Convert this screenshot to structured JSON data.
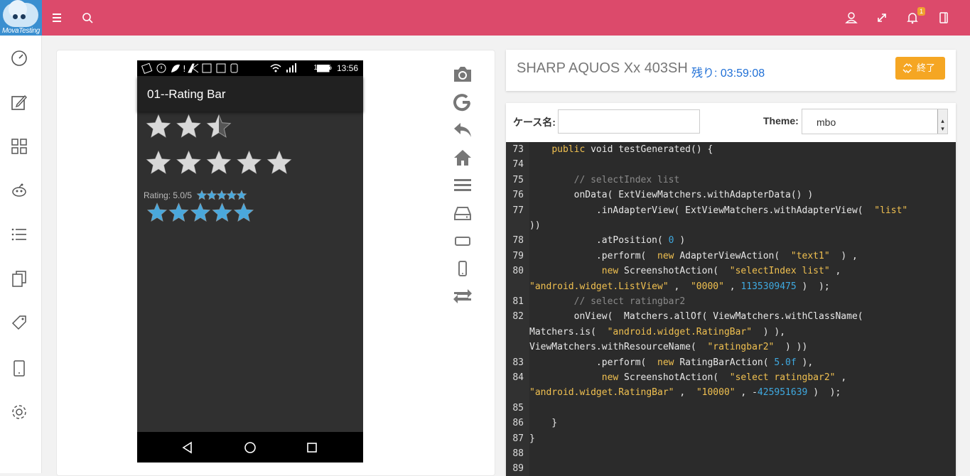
{
  "app": {
    "logo_text": "MovaTesting",
    "notification_count": "1"
  },
  "device_screen": {
    "status_battery": "100%",
    "status_time": "13:56",
    "app_title": "01--Rating Bar",
    "rating_label": "Rating: 5.0/5",
    "ratingbar1_stars": 2.5,
    "ratingbar2_stars": 5,
    "ratingbar3_stars": 5,
    "star_accent": "#4aa8dc"
  },
  "device_info": {
    "name": "SHARP AQUOS Xx 403SH",
    "remaining": "残り: 03:59:08",
    "end_button": "終了"
  },
  "editor": {
    "case_label": "ケース名:",
    "case_value": "",
    "theme_label": "Theme:",
    "theme_value": "mbo"
  },
  "colors": {
    "topbar": "#dc4a6b",
    "end_button": "#f5a623",
    "remain_text": "#1f6fd6"
  },
  "code_lines": [
    {
      "n": "73",
      "segs": [
        [
          "",
          "    "
        ],
        [
          "kw",
          "public"
        ],
        [
          "",
          " void testGenerated() {"
        ]
      ]
    },
    {
      "n": "74",
      "segs": []
    },
    {
      "n": "75",
      "segs": [
        [
          "",
          "        "
        ],
        [
          "cm",
          "// selectIndex list"
        ]
      ]
    },
    {
      "n": "76",
      "segs": [
        [
          "",
          "        onData( ExtViewMatchers.withAdapterData() )"
        ]
      ]
    },
    {
      "n": "77",
      "segs": [
        [
          "",
          "            .inAdapterView( ExtViewMatchers.withAdapterView(  "
        ],
        [
          "st",
          "\"list\""
        ]
      ]
    },
    {
      "n": "",
      "segs": [
        [
          "",
          "))"
        ]
      ]
    },
    {
      "n": "78",
      "segs": [
        [
          "",
          "            .atPosition( "
        ],
        [
          "nm",
          "0"
        ],
        [
          "",
          " )"
        ]
      ]
    },
    {
      "n": "79",
      "segs": [
        [
          "",
          "            .perform(  "
        ],
        [
          "kw",
          "new"
        ],
        [
          "",
          " AdapterViewAction(  "
        ],
        [
          "st",
          "\"text1\""
        ],
        [
          "",
          "  ) ,"
        ]
      ]
    },
    {
      "n": "80",
      "segs": [
        [
          "",
          "             "
        ],
        [
          "kw",
          "new"
        ],
        [
          "",
          " ScreenshotAction(  "
        ],
        [
          "st",
          "\"selectIndex list\""
        ],
        [
          "",
          " ,"
        ]
      ]
    },
    {
      "n": "",
      "segs": [
        [
          "st",
          "\"android.widget.ListView\""
        ],
        [
          "",
          " ,  "
        ],
        [
          "st",
          "\"0000\""
        ],
        [
          "",
          " , "
        ],
        [
          "nm",
          "1135309475"
        ],
        [
          "",
          " )  );"
        ]
      ]
    },
    {
      "n": "81",
      "segs": [
        [
          "",
          "        "
        ],
        [
          "cm",
          "// select ratingbar2"
        ]
      ]
    },
    {
      "n": "82",
      "segs": [
        [
          "",
          "        onView(  Matchers.allOf( ViewMatchers.withClassName("
        ]
      ]
    },
    {
      "n": "",
      "segs": [
        [
          "",
          "Matchers.is(  "
        ],
        [
          "st",
          "\"android.widget.RatingBar\""
        ],
        [
          "",
          "  ) ),"
        ]
      ]
    },
    {
      "n": "",
      "segs": [
        [
          "",
          "ViewMatchers.withResourceName(  "
        ],
        [
          "st",
          "\"ratingbar2\""
        ],
        [
          "",
          "  ) ))"
        ]
      ]
    },
    {
      "n": "83",
      "segs": [
        [
          "",
          "            .perform(  "
        ],
        [
          "kw",
          "new"
        ],
        [
          "",
          " RatingBarAction( "
        ],
        [
          "nm",
          "5.0f"
        ],
        [
          "",
          " ),"
        ]
      ]
    },
    {
      "n": "84",
      "segs": [
        [
          "",
          "             "
        ],
        [
          "kw",
          "new"
        ],
        [
          "",
          " ScreenshotAction(  "
        ],
        [
          "st",
          "\"select ratingbar2\""
        ],
        [
          "",
          " ,"
        ]
      ]
    },
    {
      "n": "",
      "segs": [
        [
          "st",
          "\"android.widget.RatingBar\""
        ],
        [
          "",
          " ,  "
        ],
        [
          "st",
          "\"10000\""
        ],
        [
          "",
          " , -"
        ],
        [
          "nm",
          "425951639"
        ],
        [
          "",
          " )  );"
        ]
      ]
    },
    {
      "n": "85",
      "segs": []
    },
    {
      "n": "86",
      "segs": [
        [
          "",
          "    }"
        ]
      ]
    },
    {
      "n": "87",
      "segs": [
        [
          "",
          "}"
        ]
      ]
    },
    {
      "n": "88",
      "segs": []
    },
    {
      "n": "89",
      "segs": []
    }
  ]
}
